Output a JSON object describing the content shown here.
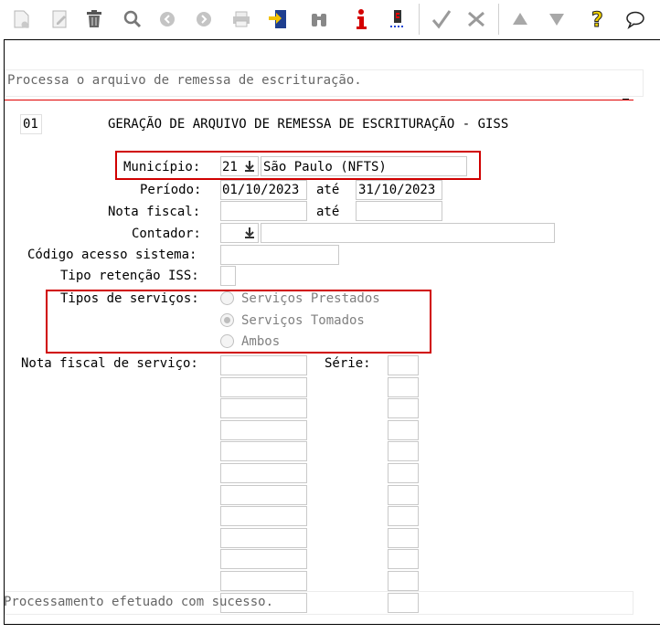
{
  "toolbar": {
    "icons": [
      "new-document",
      "edit",
      "delete",
      "search",
      "previous",
      "next",
      "print",
      "export",
      "binoculars",
      "info",
      "report",
      "confirm",
      "cancel",
      "up",
      "down",
      "help",
      "comment"
    ]
  },
  "message": "Processa o arquivo de remessa de escrituração.",
  "form": {
    "code": "01",
    "title": "GERAÇÃO DE ARQUIVO DE REMESSA DE ESCRITURAÇÃO - GISS",
    "municipio_label": "Município:",
    "municipio_code": "21",
    "municipio_name": "São Paulo (NFTS)",
    "periodo_label": "Período:",
    "periodo_start": "01/10/2023",
    "ate_label": "até",
    "periodo_end": "31/10/2023",
    "nota_fiscal_label": "Nota fiscal:",
    "nota_fiscal_start": "",
    "nota_fiscal_end": "",
    "contador_label": "Contador:",
    "contador_value": "",
    "codigo_acesso_label": "Código acesso sistema:",
    "codigo_acesso_value": "",
    "tipo_retencao_label": "Tipo retenção ISS:",
    "tipo_retencao_value": "",
    "tipos_servicos_label": "Tipos de serviços:",
    "tipos_servicos_options": [
      "Serviços Prestados",
      "Serviços Tomados",
      "Ambos"
    ],
    "tipos_servicos_selected": "Serviços Tomados",
    "nf_servico_label": "Nota fiscal de serviço:",
    "serie_label": "Série:"
  },
  "status": "Processamento efetuado com sucesso."
}
